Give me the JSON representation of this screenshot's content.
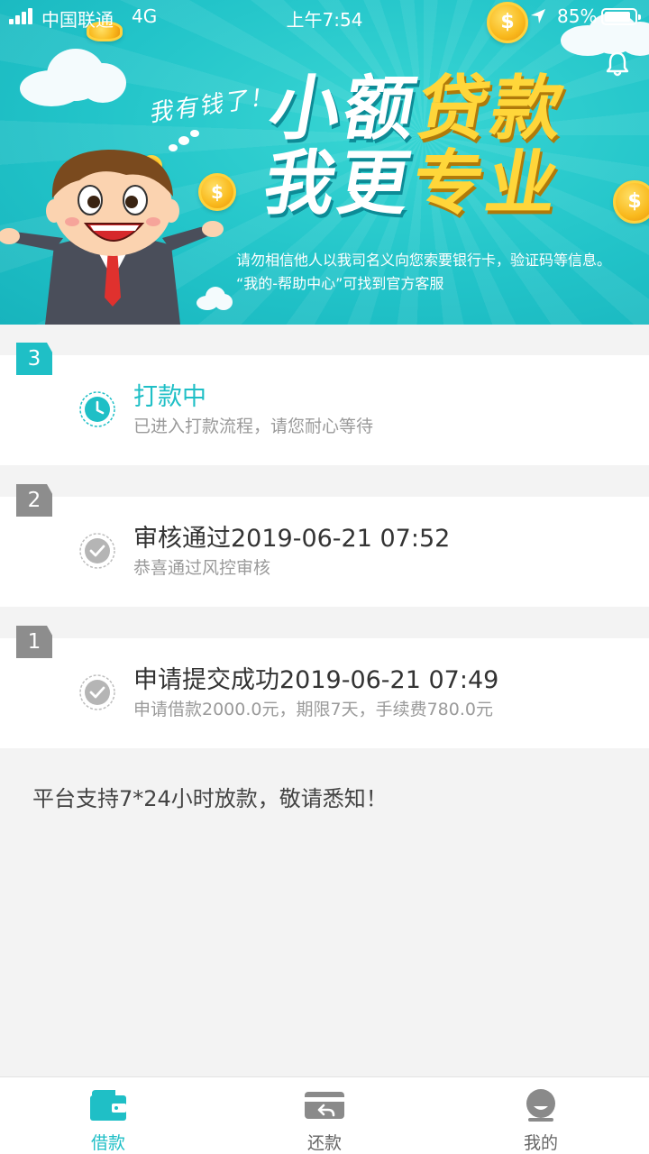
{
  "status_bar": {
    "carrier": "中国联通",
    "network": "4G",
    "time": "上午7:54",
    "battery": "85%"
  },
  "banner": {
    "tagline": "我有钱了！",
    "title_line1_white": "小额",
    "title_line1_yellow": "贷款",
    "title_line2_white": "我更",
    "title_line2_yellow": "专业",
    "notice_line1": "请勿相信他人以我司名义向您索要银行卡，验证码等信息。",
    "notice_line2": "“我的-帮助中心”可找到官方客服"
  },
  "steps": [
    {
      "number": "3",
      "title": "打款中",
      "subtitle": "已进入打款流程，请您耐心等待",
      "state": "active",
      "icon": "clock-icon"
    },
    {
      "number": "2",
      "title": "审核通过2019-06-21 07:52",
      "subtitle": "恭喜通过风控审核",
      "state": "done",
      "icon": "check-icon"
    },
    {
      "number": "1",
      "title": "申请提交成功2019-06-21 07:49",
      "subtitle": "申请借款2000.0元，期限7天，手续费780.0元",
      "state": "done",
      "icon": "check-icon"
    }
  ],
  "footnote": "平台支持7*24小时放款，敬请悉知！",
  "tabbar": {
    "tabs": [
      {
        "label": "借款",
        "icon": "wallet-icon",
        "active": true
      },
      {
        "label": "还款",
        "icon": "repay-card-icon",
        "active": false
      },
      {
        "label": "我的",
        "icon": "profile-icon",
        "active": false
      }
    ]
  },
  "colors": {
    "accent": "#1fbfc6",
    "banner_bg": "#22c4c9",
    "title_yellow": "#ffd63a",
    "done_gray": "#8d8d8d",
    "page_bg": "#f3f3f3"
  }
}
